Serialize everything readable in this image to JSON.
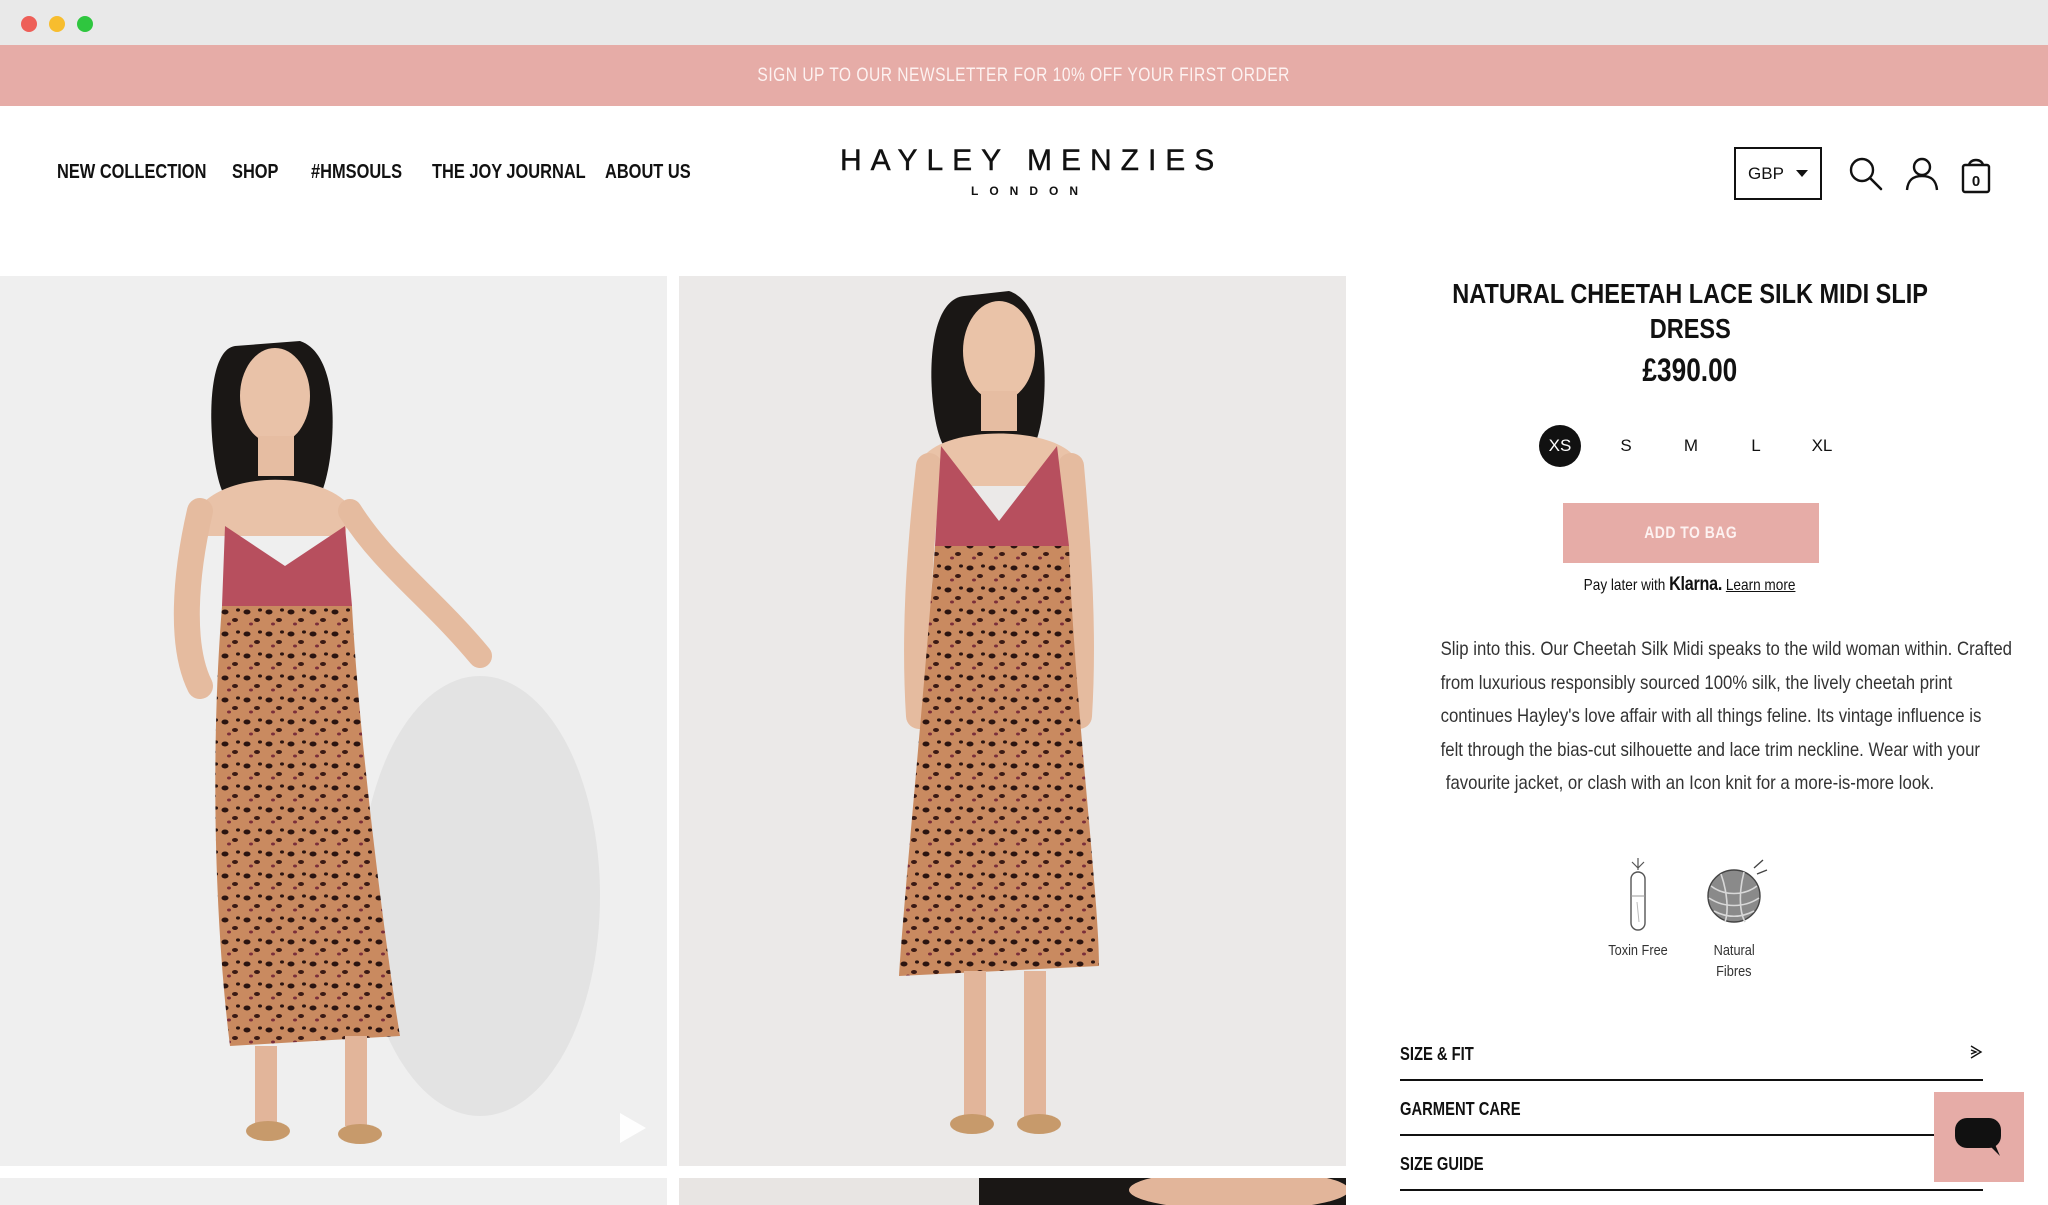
{
  "announcement": {
    "text": "SIGN UP TO OUR NEWSLETTER FOR 10% OFF YOUR FIRST ORDER"
  },
  "nav": {
    "items": [
      "NEW COLLECTION",
      "SHOP",
      "#HMSOULS",
      "THE JOY JOURNAL",
      "ABOUT US"
    ]
  },
  "logo": {
    "brand": "HAYLEY MENZIES",
    "city": "LONDON"
  },
  "header": {
    "currency": "GBP",
    "bag_count": "0",
    "icons": [
      "search-icon",
      "account-icon",
      "shopping-bag-icon"
    ]
  },
  "product": {
    "title_line1": "NATURAL CHEETAH LACE SILK MIDI SLIP",
    "title_line2": "DRESS",
    "price": "£390.00",
    "sizes": [
      "XS",
      "S",
      "M",
      "L",
      "XL"
    ],
    "selected_size": "XS",
    "add_to_bag": "ADD TO BAG",
    "klarna_prefix": "Pay later with",
    "klarna_brand": "Klarna.",
    "klarna_link": "Learn more",
    "description_lines": [
      "Slip into this. Our Cheetah Silk Midi speaks to the wild woman within. Crafted",
      "from luxurious responsibly sourced 100% silk, the lively cheetah print",
      "continues Hayley's love affair with all things feline. Its vintage influence is",
      "felt through the bias-cut silhouette and lace trim neckline. Wear with your",
      "favourite jacket, or clash with an Icon knit for a more-is-more look."
    ],
    "badges": [
      {
        "line1": "Toxin Free",
        "line2": ""
      },
      {
        "line1": "Natural",
        "line2": "Fibres"
      }
    ],
    "accordions": [
      "SIZE & FIT",
      "GARMENT CARE",
      "SIZE GUIDE"
    ]
  },
  "colors": {
    "accent_pink": "#e6aca7",
    "text": "#111111",
    "chrome": "#e9e9e9"
  }
}
